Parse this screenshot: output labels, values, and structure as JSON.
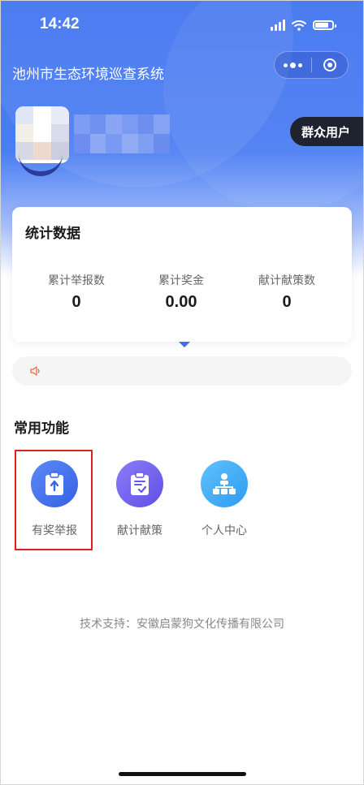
{
  "status_bar": {
    "time": "14:42",
    "battery_level": 0.8
  },
  "header": {
    "title": "池州市生态环境巡查系统"
  },
  "profile": {
    "role_badge": "群众用户"
  },
  "stats": {
    "title": "统计数据",
    "items": [
      {
        "label": "累计举报数",
        "value": "0"
      },
      {
        "label": "累计奖金",
        "value": "0.00"
      },
      {
        "label": "献计献策数",
        "value": "0"
      }
    ]
  },
  "features": {
    "title": "常用功能",
    "items": [
      {
        "label": "有奖举报",
        "icon": "clipboard-upload-icon"
      },
      {
        "label": "献计献策",
        "icon": "clipboard-check-icon"
      },
      {
        "label": "个人中心",
        "icon": "org-chart-icon"
      }
    ]
  },
  "footer": {
    "text": "技术支持：安徽启蒙狗文化传播有限公司"
  },
  "colors": {
    "primary": "#3f73f0",
    "highlight": "#e02020",
    "badge_bg": "#1f2330",
    "speaker": "#f06a3d"
  }
}
